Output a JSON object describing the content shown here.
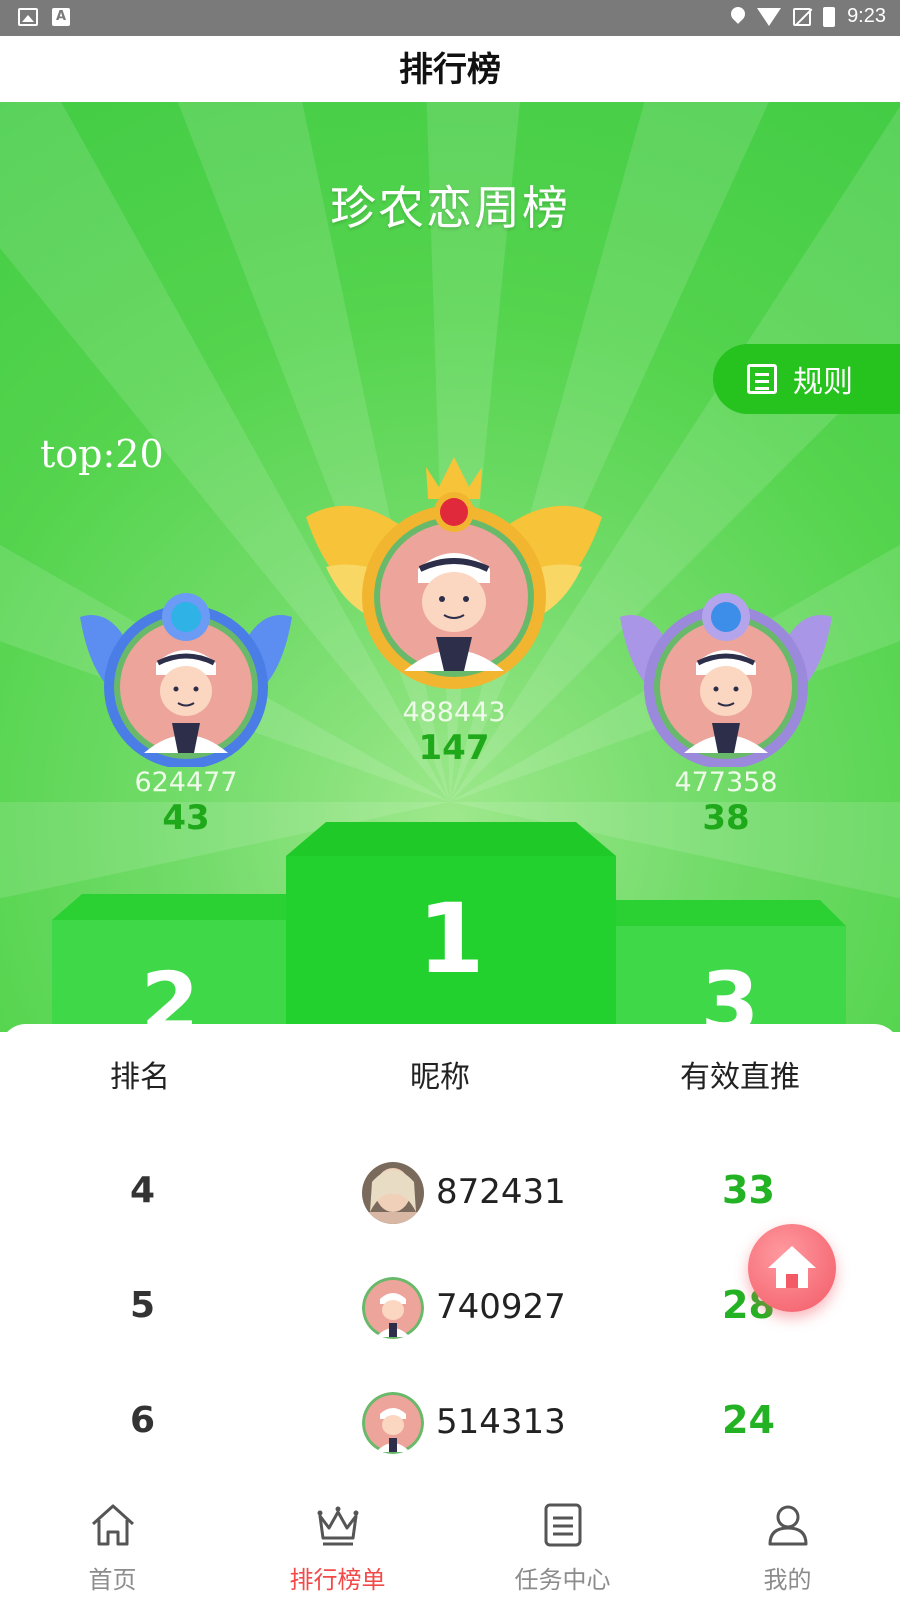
{
  "status_bar": {
    "time": "9:23",
    "icons": [
      "image-icon",
      "a-icon",
      "location-icon",
      "wifi-icon",
      "no-sim-icon",
      "battery-charging-icon"
    ]
  },
  "header": {
    "title": "排行榜"
  },
  "hero": {
    "board_title": "珍农恋周榜",
    "rules_label": "规则",
    "top_label": "top:20",
    "podium": {
      "first": {
        "uid": "488443",
        "score": "147",
        "block_label": "1"
      },
      "second": {
        "uid": "624477",
        "score": "43",
        "block_label": "2"
      },
      "third": {
        "uid": "477358",
        "score": "38",
        "block_label": "3"
      }
    },
    "colors": {
      "green": "#43cc45",
      "dark_green": "#1ea81a",
      "gold": "#f7c338",
      "blue": "#5b8ef0",
      "purple": "#a996e6"
    }
  },
  "table": {
    "headers": {
      "rank": "排名",
      "nickname": "昵称",
      "effective": "有效直推"
    },
    "rows": [
      {
        "rank": "4",
        "nickname": "872431",
        "effective": "33",
        "avatar": "photo-avatar"
      },
      {
        "rank": "5",
        "nickname": "740927",
        "effective": "28",
        "avatar": "cartoon-avatar"
      },
      {
        "rank": "6",
        "nickname": "514313",
        "effective": "24",
        "avatar": "cartoon-avatar"
      }
    ]
  },
  "fab": {
    "icon": "home-icon",
    "color": "#f25a66"
  },
  "bottom_nav": {
    "items": [
      {
        "label": "首页",
        "icon": "home-icon",
        "active": false
      },
      {
        "label": "排行榜单",
        "icon": "crown-icon",
        "active": true
      },
      {
        "label": "任务中心",
        "icon": "task-list-icon",
        "active": false
      },
      {
        "label": "我的",
        "icon": "user-icon",
        "active": false
      }
    ],
    "active_color": "#f24949"
  }
}
